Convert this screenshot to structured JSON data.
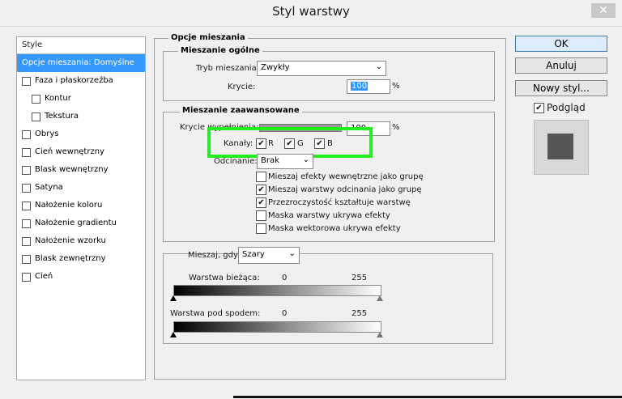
{
  "window": {
    "title": "Styl warstwy",
    "close_symbol": "✕"
  },
  "styles_list": {
    "header": "Style",
    "items": [
      {
        "label": "Opcje mieszania: Domyślne",
        "selected": true,
        "checkbox": false
      },
      {
        "label": "Faza i płaskorzeźba",
        "checkbox": true
      },
      {
        "label": "Kontur",
        "checkbox": true,
        "indent": true
      },
      {
        "label": "Tekstura",
        "checkbox": true,
        "indent": true
      },
      {
        "label": "Obrys",
        "checkbox": true
      },
      {
        "label": "Cień wewnętrzny",
        "checkbox": true
      },
      {
        "label": "Blask wewnętrzny",
        "checkbox": true
      },
      {
        "label": "Satyna",
        "checkbox": true
      },
      {
        "label": "Nałożenie koloru",
        "checkbox": true
      },
      {
        "label": "Nałożenie gradientu",
        "checkbox": true
      },
      {
        "label": "Nałożenie wzorku",
        "checkbox": true
      },
      {
        "label": "Blask zewnętrzny",
        "checkbox": true
      },
      {
        "label": "Cień",
        "checkbox": true
      }
    ]
  },
  "blending_options": {
    "title": "Opcje mieszania",
    "general": {
      "title": "Mieszanie ogólne",
      "mode_label": "Tryb mieszania:",
      "mode_value": "Zwykły",
      "opacity_label": "Krycie:",
      "opacity_value": "100",
      "percent": "%"
    },
    "advanced": {
      "title": "Mieszanie zaawansowane",
      "fill_label": "Krycie wypełnienia:",
      "fill_value": "100",
      "percent": "%",
      "channels_label": "Kanały:",
      "channels": [
        {
          "label": "R",
          "checked": true
        },
        {
          "label": "G",
          "checked": true
        },
        {
          "label": "B",
          "checked": true
        }
      ],
      "knockout_label": "Odcinanie:",
      "knockout_value": "Brak",
      "options": [
        {
          "label": "Mieszaj efekty wewnętrzne jako grupę",
          "checked": false
        },
        {
          "label": "Mieszaj warstwy odcinania jako grupę",
          "checked": true
        },
        {
          "label": "Przezroczystość kształtuje warstwę",
          "checked": true
        },
        {
          "label": "Maska warstwy ukrywa efekty",
          "checked": false
        },
        {
          "label": "Maska wektorowa ukrywa efekty",
          "checked": false
        }
      ]
    },
    "blend_if": {
      "label": "Mieszaj, gdy:",
      "value": "Szary",
      "this_layer": {
        "label": "Warstwa bieżąca:",
        "min": "0",
        "max": "255"
      },
      "underlying": {
        "label": "Warstwa pod spodem:",
        "min": "0",
        "max": "255"
      }
    }
  },
  "buttons": {
    "ok": "OK",
    "cancel": "Anuluj",
    "new_style": "Nowy styl...",
    "preview_label": "Podgląd"
  },
  "colors": {
    "highlight": "#3399ff",
    "annotation": "#22ee22"
  }
}
